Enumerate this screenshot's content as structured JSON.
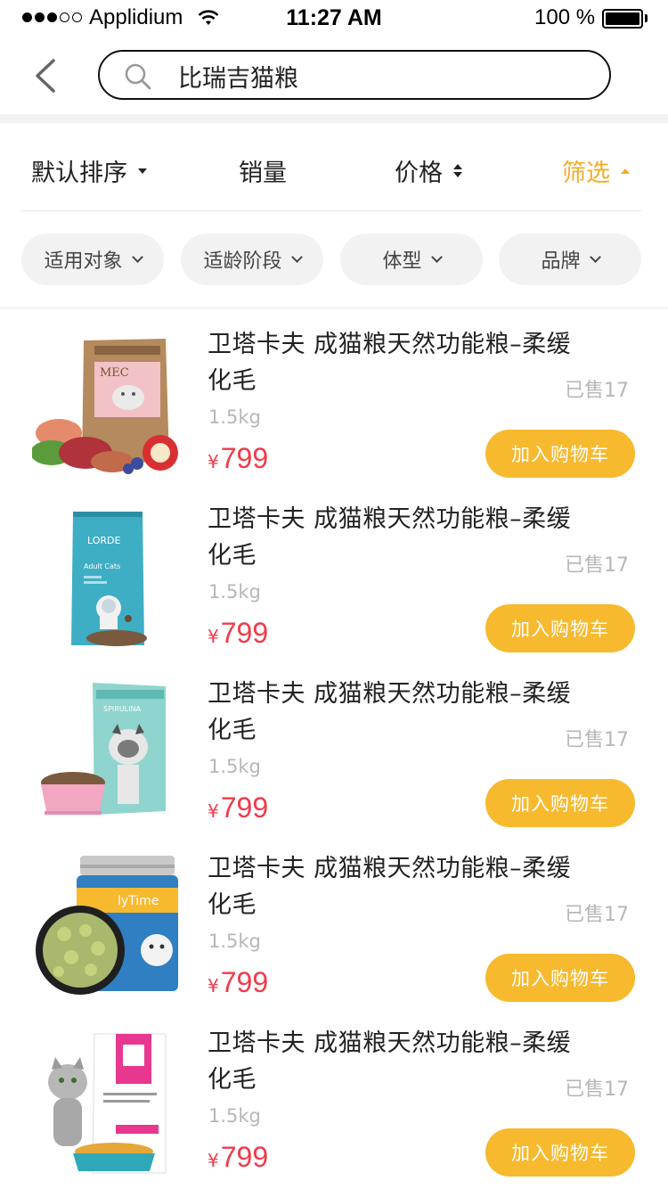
{
  "status_bar": {
    "carrier": "Applidium",
    "time": "11:27 AM",
    "battery": "100 %"
  },
  "search": {
    "query": "比瑞吉猫粮"
  },
  "sort": {
    "default_label": "默认排序",
    "sales_label": "销量",
    "price_label": "价格",
    "filter_label": "筛选"
  },
  "filters": [
    {
      "label": "适用对象"
    },
    {
      "label": "适龄阶段"
    },
    {
      "label": "体型"
    },
    {
      "label": "品牌"
    }
  ],
  "colors": {
    "accent": "#f4ac2a",
    "button": "#f7b92e",
    "price": "#ef3b4a"
  },
  "products": [
    {
      "title": "卫塔卡夫 成猫粮天然功能粮–柔缓化毛",
      "sold": "已售17",
      "weight": "1.5kg",
      "currency": "¥",
      "price": "799",
      "cart_label": "加入购物车",
      "thumb": "pink-kraft-bag"
    },
    {
      "title": "卫塔卡夫 成猫粮天然功能粮–柔缓化毛",
      "sold": "已售17",
      "weight": "1.5kg",
      "currency": "¥",
      "price": "799",
      "cart_label": "加入购物车",
      "thumb": "blue-lorde-bag"
    },
    {
      "title": "卫塔卡夫 成猫粮天然功能粮–柔缓化毛",
      "sold": "已售17",
      "weight": "1.5kg",
      "currency": "¥",
      "price": "799",
      "cart_label": "加入购物车",
      "thumb": "teal-cat-bag"
    },
    {
      "title": "卫塔卡夫 成猫粮天然功能粮–柔缓化毛",
      "sold": "已售17",
      "weight": "1.5kg",
      "currency": "¥",
      "price": "799",
      "cart_label": "加入购物车",
      "thumb": "treat-jar"
    },
    {
      "title": "卫塔卡夫 成猫粮天然功能粮–柔缓化毛",
      "sold": "已售17",
      "weight": "1.5kg",
      "currency": "¥",
      "price": "799",
      "cart_label": "加入购物车",
      "thumb": "white-pink-bag"
    }
  ]
}
